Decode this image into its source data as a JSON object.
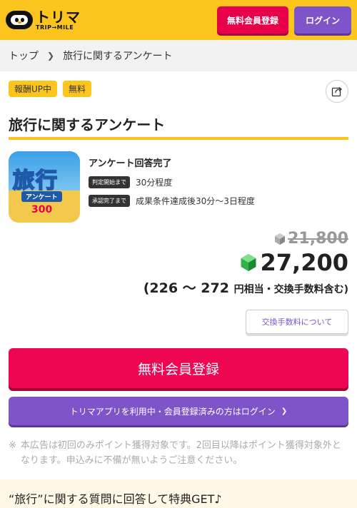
{
  "header": {
    "logo_main": "トリマ",
    "logo_sub": "TRIP→MILE",
    "register_label": "無料会員登録",
    "login_label": "ログイン"
  },
  "breadcrumb": {
    "home": "トップ",
    "current": "旅行に関するアンケート"
  },
  "badges": [
    "報酬UP中",
    "無料"
  ],
  "title": "旅行に関するアンケート",
  "thumbnail": {
    "big_text": "旅行",
    "small_text": "アンケート",
    "number_text": "300"
  },
  "condition": {
    "title": "アンケート回答完了",
    "rows": [
      {
        "chip": "判定開始まで",
        "text": "30分程度"
      },
      {
        "chip": "承認完了まで",
        "text": "成果条件達成後30分～3日程度"
      }
    ]
  },
  "points": {
    "old_value": "21,800",
    "new_value": "27,200",
    "yen_range": "(226 〜 272",
    "yen_note": "円相当・交換手数料含む)"
  },
  "fee_button_label": "交換手数料について",
  "cta": {
    "register_label": "無料会員登録",
    "login_label": "トリマアプリを利用中・会員登録済みの方はログイン"
  },
  "note": {
    "mark": "※",
    "text": "本広告は初回のみポイント獲得対象です。2回目以降はポイント獲得対象外となります。申込みに不備が無いようご注意ください。"
  },
  "section_heading": "“旅行”に関する質問に回答して特典GET♪",
  "colors": {
    "brand_yellow": "#fcc51e",
    "register_red": "#ee0653",
    "login_purple": "#7e54c8"
  }
}
